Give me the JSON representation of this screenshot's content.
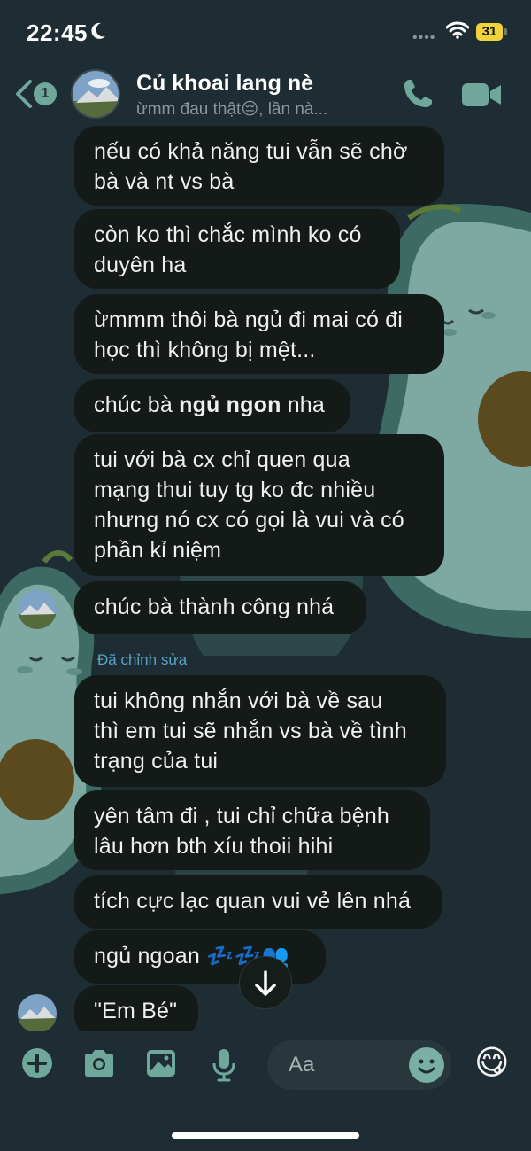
{
  "status_bar": {
    "time": "22:45",
    "battery": "31"
  },
  "header": {
    "back_badge": "1",
    "contact_name": "Củ khoai lang nè",
    "contact_status": "ừmm đau thật😔, lần nà..."
  },
  "messages": [
    {
      "lines": [
        "nếu có khả năng tui vẫn sẽ chờ",
        "bà và nt vs bà"
      ]
    },
    {
      "lines": [
        "còn ko thì chắc mình ko có",
        "duyên ha"
      ]
    },
    {
      "lines": [
        "ừmmm thôi bà ngủ đi mai có đi",
        "học thì không bị mệt..."
      ]
    },
    {
      "pre": "chúc bà ",
      "bold": "ngủ ngon",
      "post": " nha"
    },
    {
      "lines": [
        "tui với bà cx chỉ quen qua",
        "mạng thui tuy tg ko đc nhiều",
        "nhưng nó cx có gọi là vui và có",
        "phần kỉ niệm"
      ]
    },
    {
      "lines": [
        "chúc bà thành công nhá"
      ]
    },
    {
      "lines": [
        "tui không nhắn với bà về sau",
        "thì em tui sẽ nhắn vs bà về tình",
        "trạng của tui"
      ]
    },
    {
      "lines": [
        "yên tâm đi , tui chỉ chữa bệnh",
        "lâu hơn bth xíu thoii hihi"
      ]
    },
    {
      "lines": [
        "tích cực lạc quan vui vẻ lên nhá"
      ]
    },
    {
      "lines": [
        "ngủ ngoan 💤💤👥"
      ]
    },
    {
      "lines": [
        "\"Em Bé\""
      ]
    }
  ],
  "edited_label": "Đã chỉnh sửa",
  "composer": {
    "placeholder": "Aa",
    "reaction_emoji": "😋"
  },
  "icons": [
    "moon-icon",
    "wifi-icon",
    "back-chevron-icon",
    "phone-icon",
    "video-icon",
    "plus-icon",
    "camera-icon",
    "image-icon",
    "microphone-icon",
    "emoji-icon",
    "arrow-down-icon"
  ],
  "colors": {
    "accent": "#6fa79a",
    "bubble": "#131a17",
    "background": "#1e2d33",
    "edited": "#5aa3c7"
  }
}
